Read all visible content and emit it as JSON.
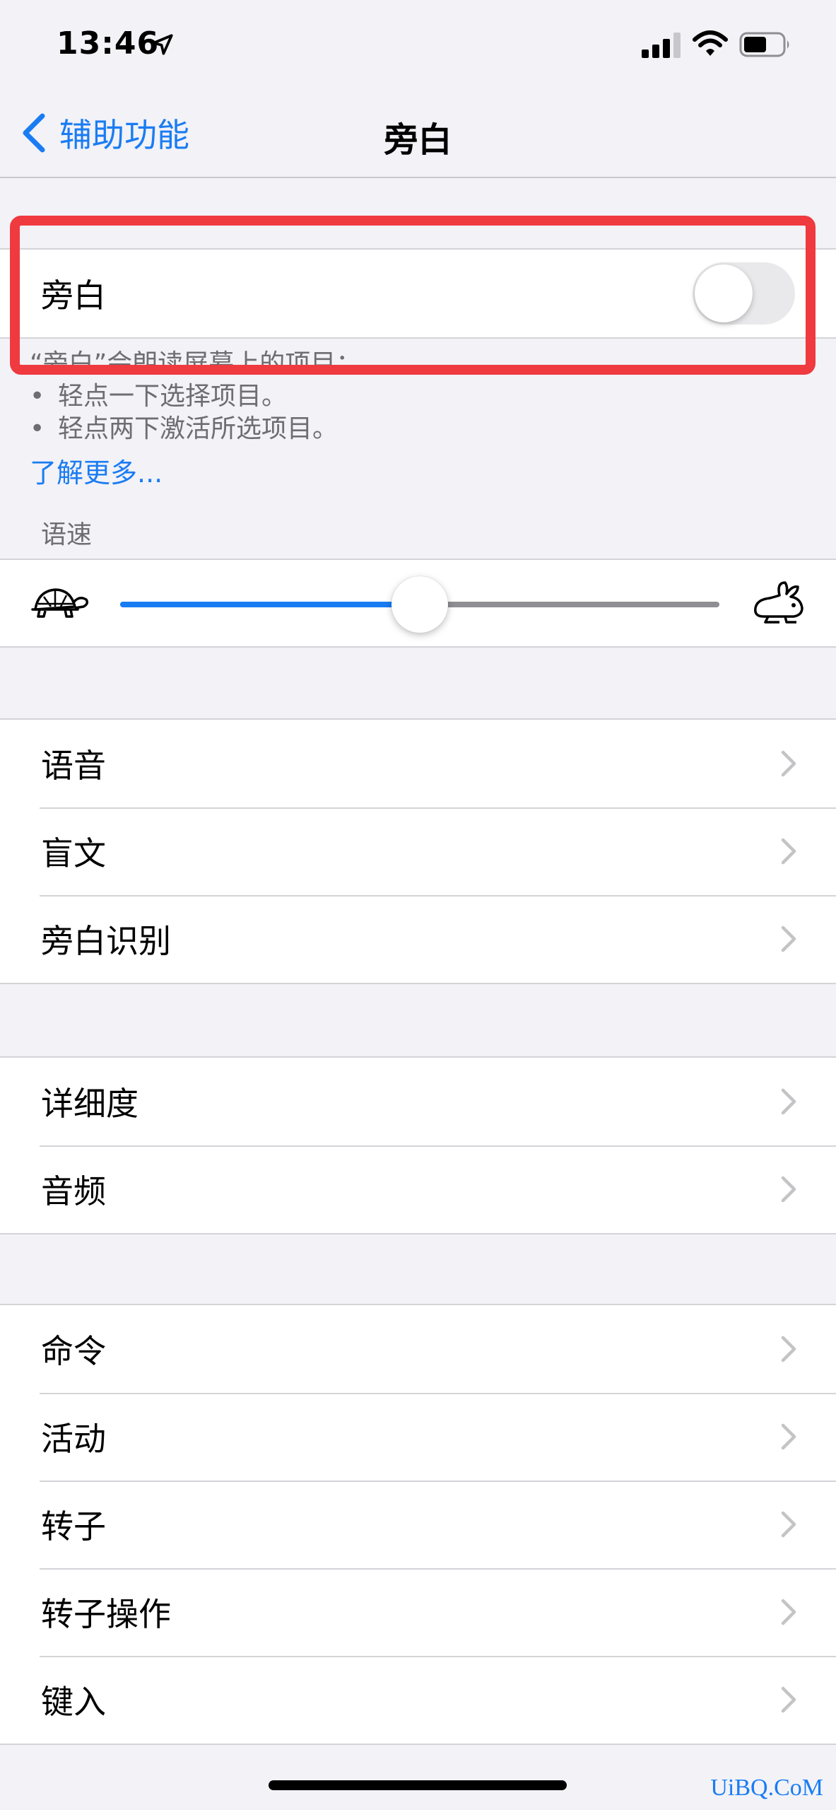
{
  "status_bar": {
    "time": "13:46",
    "icons": [
      "location-arrow-icon",
      "cellular-signal-icon",
      "wifi-icon",
      "battery-icon"
    ]
  },
  "nav": {
    "back_label": "辅助功能",
    "title": "旁白"
  },
  "voiceover_toggle": {
    "label": "旁白",
    "on": false
  },
  "footer": {
    "intro": "“旁白”会朗读屏幕上的项目：",
    "bullets": [
      "轻点一下选择项目。",
      "轻点两下激活所选项目。"
    ],
    "learn_more": "了解更多..."
  },
  "speech_rate": {
    "header": "语速",
    "value": 0.5,
    "icons": [
      "turtle-icon",
      "rabbit-icon"
    ]
  },
  "group1": [
    {
      "label": "语音"
    },
    {
      "label": "盲文"
    },
    {
      "label": "旁白识别"
    }
  ],
  "group2": [
    {
      "label": "详细度"
    },
    {
      "label": "音频"
    }
  ],
  "group3": [
    {
      "label": "命令"
    },
    {
      "label": "活动"
    },
    {
      "label": "转子"
    },
    {
      "label": "转子操作"
    },
    {
      "label": "键入"
    }
  ],
  "watermark": "UiBQ.CoM",
  "colors": {
    "accent": "#1a7cf2",
    "highlight": "#ef3a3f",
    "background": "#f2f2f7"
  }
}
